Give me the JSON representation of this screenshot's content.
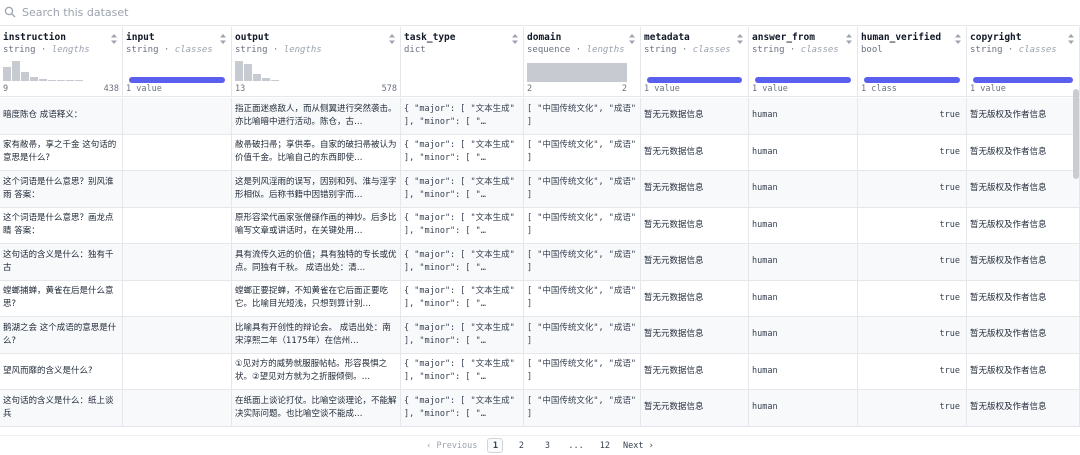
{
  "search": {
    "placeholder": "Search this dataset"
  },
  "columns": [
    {
      "key": "instruction",
      "name": "instruction",
      "type": "string",
      "sub": "lengths",
      "viz": "hist",
      "hist": [
        0.7,
        1.0,
        0.45,
        0.2,
        0.08,
        0.06,
        0.04,
        0.03,
        0.02
      ],
      "min": "9",
      "max": "438"
    },
    {
      "key": "input",
      "name": "input",
      "type": "string",
      "sub": "classes",
      "viz": "class",
      "foot": "1 value"
    },
    {
      "key": "output",
      "name": "output",
      "type": "string",
      "sub": "lengths",
      "viz": "hist",
      "hist": [
        1.0,
        0.85,
        0.35,
        0.15,
        0.06
      ],
      "min": "13",
      "max": "578"
    },
    {
      "key": "task_type",
      "name": "task_type",
      "type": "dict",
      "sub": "",
      "viz": "none"
    },
    {
      "key": "domain",
      "name": "domain",
      "type": "sequence",
      "sub": "lengths",
      "viz": "seq",
      "min": "2",
      "max": "2"
    },
    {
      "key": "metadata",
      "name": "metadata",
      "type": "string",
      "sub": "classes",
      "viz": "class",
      "foot": "1 value"
    },
    {
      "key": "answer_from",
      "name": "answer_from",
      "type": "string",
      "sub": "classes",
      "viz": "class",
      "foot": "1 value"
    },
    {
      "key": "human_verified",
      "name": "human_verified",
      "type": "bool",
      "sub": "",
      "viz": "class",
      "foot": "1 class"
    },
    {
      "key": "copyright",
      "name": "copyright",
      "type": "string",
      "sub": "classes",
      "viz": "class",
      "foot": "1 value"
    }
  ],
  "rows": [
    {
      "instruction": "暗度陈仓 成语释义：",
      "input": "",
      "output": "指正面迷惑敌人，而从侧翼进行突然袭击。亦比喻暗中进行活动。陈仓，古…",
      "task_type": "{ \"major\": [ \"文本生成\" ], \"minor\": [ \"…",
      "domain": "[ \"中国传统文化\", \"成语\" ]",
      "metadata": "暂无元数据信息",
      "answer_from": "human",
      "human_verified": "true",
      "copyright": "暂无版权及作者信息"
    },
    {
      "instruction": "家有敝帚，享之千金 这句话的意思是什么?",
      "input": "",
      "output": "敝帚破扫帚；享供奉。自家的破扫帚被认为价值千金。比喻自己的东西即使…",
      "task_type": "{ \"major\": [ \"文本生成\" ], \"minor\": [ \"…",
      "domain": "[ \"中国传统文化\", \"成语\" ]",
      "metadata": "暂无元数据信息",
      "answer_from": "human",
      "human_verified": "true",
      "copyright": "暂无版权及作者信息"
    },
    {
      "instruction": "这个词语是什么意思？别风淮雨 答案：",
      "input": "",
      "output": "这是列风淫雨的误写，因别和列、淮与淫字形相似。后称书籍中因错别字而…",
      "task_type": "{ \"major\": [ \"文本生成\" ], \"minor\": [ \"…",
      "domain": "[ \"中国传统文化\", \"成语\" ]",
      "metadata": "暂无元数据信息",
      "answer_from": "human",
      "human_verified": "true",
      "copyright": "暂无版权及作者信息"
    },
    {
      "instruction": "这个词语是什么意思？画龙点睛 答案：",
      "input": "",
      "output": "原形容梁代画家张僧繇作画的神妙。后多比喻写文章或讲话时，在关键处用…",
      "task_type": "{ \"major\": [ \"文本生成\" ], \"minor\": [ \"…",
      "domain": "[ \"中国传统文化\", \"成语\" ]",
      "metadata": "暂无元数据信息",
      "answer_from": "human",
      "human_verified": "true",
      "copyright": "暂无版权及作者信息"
    },
    {
      "instruction": "这句话的含义是什么：独有千古",
      "input": "",
      "output": "具有流传久远的价值；具有独特的专长或优点。同独有千秋。 成语出处：清…",
      "task_type": "{ \"major\": [ \"文本生成\" ], \"minor\": [ \"…",
      "domain": "[ \"中国传统文化\", \"成语\" ]",
      "metadata": "暂无元数据信息",
      "answer_from": "human",
      "human_verified": "true",
      "copyright": "暂无版权及作者信息"
    },
    {
      "instruction": "螳螂捕蝉，黄雀在后是什么意思?",
      "input": "",
      "output": "螳螂正要捉蝉，不知黄雀在它后面正要吃它。比喻目光短浅，只想到算计别…",
      "task_type": "{ \"major\": [ \"文本生成\" ], \"minor\": [ \"…",
      "domain": "[ \"中国传统文化\", \"成语\" ]",
      "metadata": "暂无元数据信息",
      "answer_from": "human",
      "human_verified": "true",
      "copyright": "暂无版权及作者信息"
    },
    {
      "instruction": "鹅湖之会 这个成语的意思是什么?",
      "input": "",
      "output": "比喻具有开创性的辩论会。 成语出处：南宋淳熙二年（1175年）在信州…",
      "task_type": "{ \"major\": [ \"文本生成\" ], \"minor\": [ \"…",
      "domain": "[ \"中国传统文化\", \"成语\" ]",
      "metadata": "暂无元数据信息",
      "answer_from": "human",
      "human_verified": "true",
      "copyright": "暂无版权及作者信息"
    },
    {
      "instruction": "望风而靡的含义是什么?",
      "input": "",
      "output": "①见对方的威势就服服帖帖。形容畏惧之状。②望见对方就为之折服倾倒。…",
      "task_type": "{ \"major\": [ \"文本生成\" ], \"minor\": [ \"…",
      "domain": "[ \"中国传统文化\", \"成语\" ]",
      "metadata": "暂无元数据信息",
      "answer_from": "human",
      "human_verified": "true",
      "copyright": "暂无版权及作者信息"
    },
    {
      "instruction": "这句话的含义是什么：纸上谈兵",
      "input": "",
      "output": "在纸面上谈论打仗。比喻空谈理论，不能解决实际问题。也比喻空谈不能成…",
      "task_type": "{ \"major\": [ \"文本生成\" ], \"minor\": [ \"…",
      "domain": "[ \"中国传统文化\", \"成语\" ]",
      "metadata": "暂无元数据信息",
      "answer_from": "human",
      "human_verified": "true",
      "copyright": "暂无版权及作者信息"
    }
  ],
  "pagination": {
    "prev": "‹ Previous",
    "pages": [
      "1",
      "2",
      "3",
      "...",
      "12"
    ],
    "next": "Next ›",
    "current": "1"
  }
}
